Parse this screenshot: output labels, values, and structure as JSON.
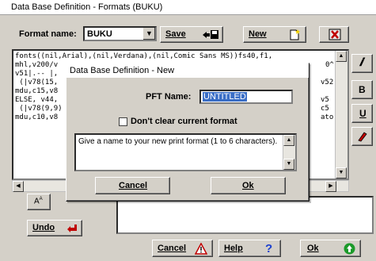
{
  "background_fragments": [
    "1",
    "C",
    "e"
  ],
  "main_window": {
    "title": "Data Base Definition - Formats (BUKU)",
    "format_name_label": "Format name:",
    "format_name_value": "BUKU",
    "buttons": {
      "save": "Save",
      "new": "New",
      "undo": "Undo",
      "cancel": "Cancel",
      "help": "Help",
      "ok": "Ok"
    },
    "code_lines": [
      "fonts((nil,Arial),(nil,Verdana),(nil,Comic Sans MS))fs40,f1,",
      "mhl,v200/v",
      "v51|.-- |,",
      " (|v78(15,",
      "mdu,c15,v8",
      "ELSE, v44,",
      " (|v78(9,9)",
      "mdu,c10,v8"
    ],
    "code_right_fragments": [
      "0^",
      "v52",
      "v5",
      "c5",
      "ato"
    ]
  },
  "dialog": {
    "title": "Data Base Definition - New",
    "pft_name_label": "PFT Name:",
    "pft_name_value": "UNTITLED",
    "checkbox_label": "Don't clear current format",
    "hint": "Give a name to your new print format (1 to 6 characters).",
    "cancel_label": "Cancel",
    "ok_label": "Ok"
  }
}
